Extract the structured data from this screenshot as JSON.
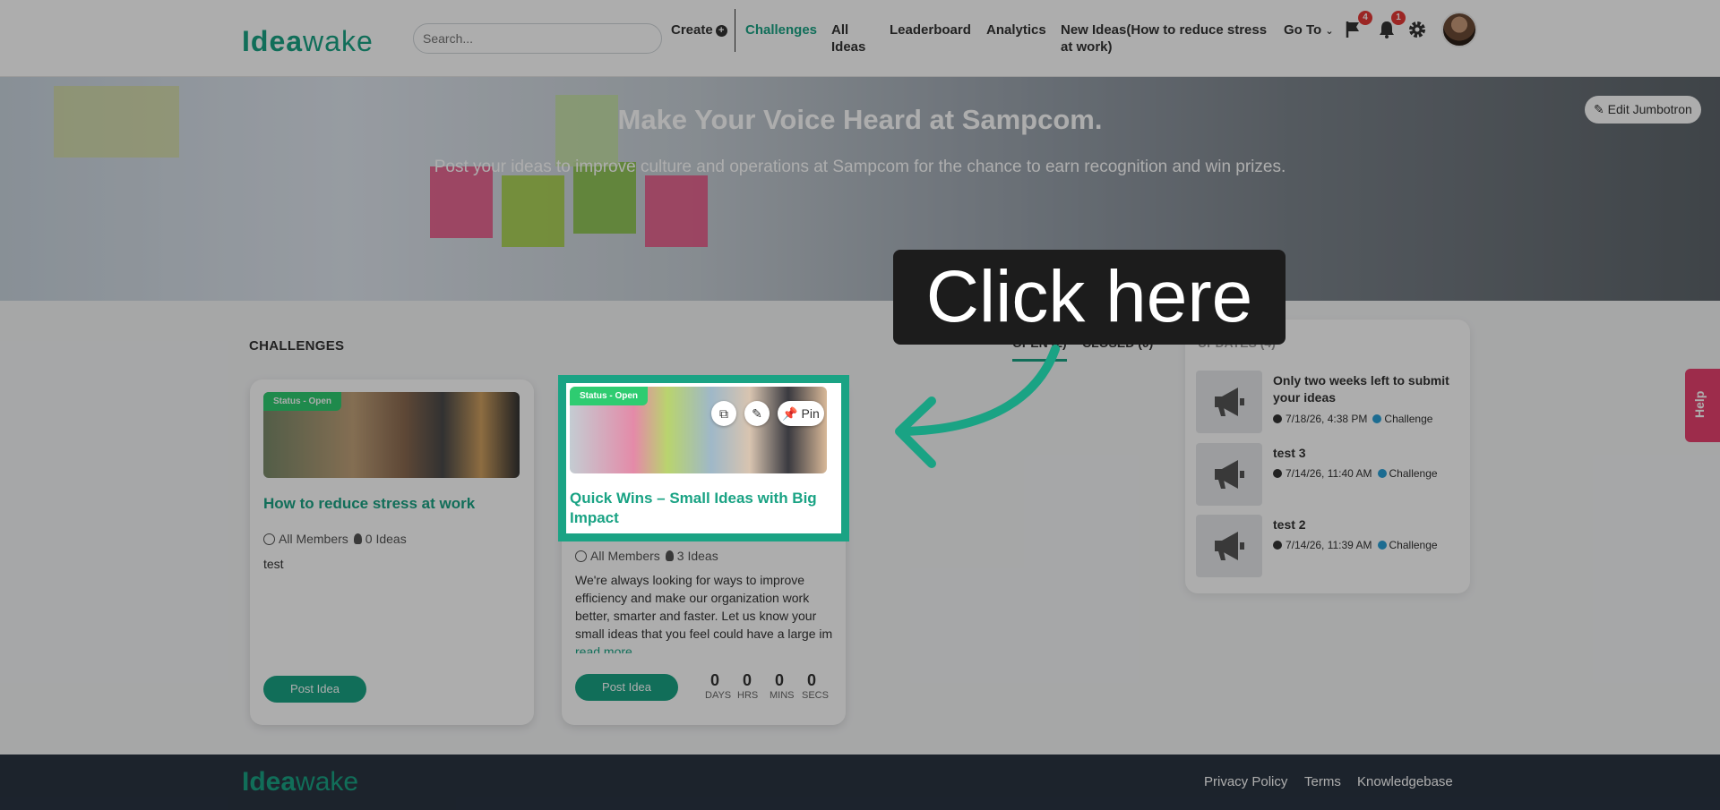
{
  "header": {
    "logo_part1": "Idea",
    "logo_part2": "wake",
    "search_placeholder": "Search...",
    "nav": {
      "create": "Create",
      "challenges": "Challenges",
      "all_ideas_1": "All",
      "all_ideas_2": "Ideas",
      "leaderboard": "Leaderboard",
      "analytics": "Analytics",
      "new_ideas_1": "New Ideas(How to reduce stress",
      "new_ideas_2": "at work)",
      "goto": "Go To"
    },
    "flag_badge": "4",
    "bell_badge": "1",
    "colors": {
      "accent": "#1aa384",
      "badge": "#e53935"
    }
  },
  "jumbotron": {
    "title": "Make Your Voice Heard at Sampcom.",
    "subtitle": "Post your ideas to improve culture and operations at Sampcom for the chance to earn recognition and win prizes.",
    "edit_button": "Edit Jumbotron"
  },
  "challenges": {
    "section_title": "CHALLENGES",
    "tab_open": "OPEN (2)",
    "tab_closed": "CLOSED (0)",
    "cards": [
      {
        "status": "Status - Open",
        "title": "How to reduce stress at work",
        "audience": "All Members",
        "ideas": "0 Ideas",
        "description": "test",
        "post_button": "Post Idea"
      },
      {
        "status": "Status - Open",
        "title_line1": "Quick Wins – Small Ideas with Big",
        "title_line2": "Impact",
        "audience": "All Members",
        "ideas": "3 Ideas",
        "description": "We're always looking for ways to improve efficiency and make our organization work better, smarter and faster. Let us know your small ideas that you feel could have a large im",
        "read_more": "read more",
        "pin_label": "Pin",
        "post_button": "Post Idea",
        "countdown": [
          {
            "value": "0",
            "label": "DAYS"
          },
          {
            "value": "0",
            "label": "HRS"
          },
          {
            "value": "0",
            "label": "MINS"
          },
          {
            "value": "0",
            "label": "SECS"
          }
        ]
      }
    ]
  },
  "updates": {
    "title": "UPDATES (4)",
    "items": [
      {
        "title": "Only two weeks left to submit your ideas",
        "time": "7/18/26, 4:38 PM",
        "type": "Challenge"
      },
      {
        "title": "test 3",
        "time": "7/14/26, 11:40 AM",
        "type": "Challenge"
      },
      {
        "title": "test 2",
        "time": "7/14/26, 11:39 AM",
        "type": "Challenge"
      }
    ]
  },
  "help": {
    "label": "Help"
  },
  "footer": {
    "logo_part1": "Idea",
    "logo_part2": "wake",
    "links": [
      "Privacy Policy",
      "Terms",
      "Knowledgebase"
    ]
  },
  "overlay": {
    "callout": "Click here"
  }
}
